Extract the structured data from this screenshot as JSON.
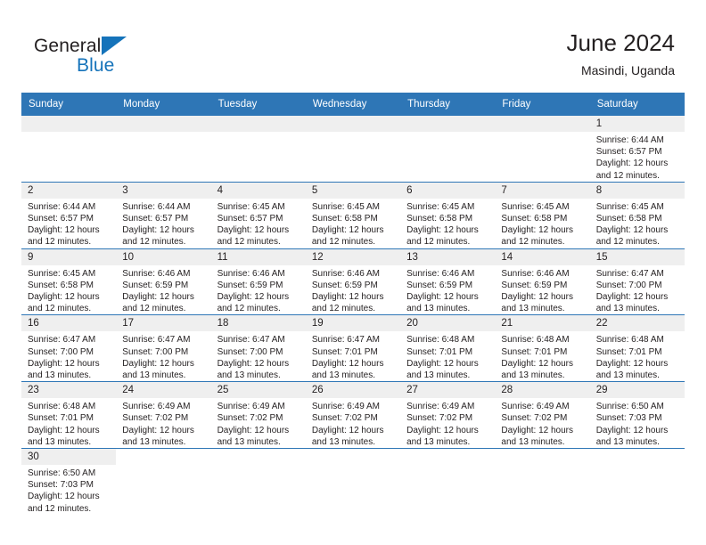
{
  "brand": {
    "name_part1": "General",
    "name_part2": "Blue",
    "triangle_color": "#1573ba"
  },
  "header": {
    "title": "June 2024",
    "subtitle": "Masindi, Uganda"
  },
  "theme": {
    "header_bg": "#2e76b6",
    "header_text": "#ffffff",
    "daynum_bg": "#efefef",
    "text": "#231f20"
  },
  "weekdays": [
    "Sunday",
    "Monday",
    "Tuesday",
    "Wednesday",
    "Thursday",
    "Friday",
    "Saturday"
  ],
  "labels": {
    "sunrise": "Sunrise:",
    "sunset": "Sunset:",
    "daylight": "Daylight:"
  },
  "weeks": [
    [
      {
        "empty": true
      },
      {
        "empty": true
      },
      {
        "empty": true
      },
      {
        "empty": true
      },
      {
        "empty": true
      },
      {
        "empty": true
      },
      {
        "day": "1",
        "sunrise": "Sunrise: 6:44 AM",
        "sunset": "Sunset: 6:57 PM",
        "daylight": "Daylight: 12 hours and 12 minutes."
      }
    ],
    [
      {
        "day": "2",
        "sunrise": "Sunrise: 6:44 AM",
        "sunset": "Sunset: 6:57 PM",
        "daylight": "Daylight: 12 hours and 12 minutes."
      },
      {
        "day": "3",
        "sunrise": "Sunrise: 6:44 AM",
        "sunset": "Sunset: 6:57 PM",
        "daylight": "Daylight: 12 hours and 12 minutes."
      },
      {
        "day": "4",
        "sunrise": "Sunrise: 6:45 AM",
        "sunset": "Sunset: 6:57 PM",
        "daylight": "Daylight: 12 hours and 12 minutes."
      },
      {
        "day": "5",
        "sunrise": "Sunrise: 6:45 AM",
        "sunset": "Sunset: 6:58 PM",
        "daylight": "Daylight: 12 hours and 12 minutes."
      },
      {
        "day": "6",
        "sunrise": "Sunrise: 6:45 AM",
        "sunset": "Sunset: 6:58 PM",
        "daylight": "Daylight: 12 hours and 12 minutes."
      },
      {
        "day": "7",
        "sunrise": "Sunrise: 6:45 AM",
        "sunset": "Sunset: 6:58 PM",
        "daylight": "Daylight: 12 hours and 12 minutes."
      },
      {
        "day": "8",
        "sunrise": "Sunrise: 6:45 AM",
        "sunset": "Sunset: 6:58 PM",
        "daylight": "Daylight: 12 hours and 12 minutes."
      }
    ],
    [
      {
        "day": "9",
        "sunrise": "Sunrise: 6:45 AM",
        "sunset": "Sunset: 6:58 PM",
        "daylight": "Daylight: 12 hours and 12 minutes."
      },
      {
        "day": "10",
        "sunrise": "Sunrise: 6:46 AM",
        "sunset": "Sunset: 6:59 PM",
        "daylight": "Daylight: 12 hours and 12 minutes."
      },
      {
        "day": "11",
        "sunrise": "Sunrise: 6:46 AM",
        "sunset": "Sunset: 6:59 PM",
        "daylight": "Daylight: 12 hours and 12 minutes."
      },
      {
        "day": "12",
        "sunrise": "Sunrise: 6:46 AM",
        "sunset": "Sunset: 6:59 PM",
        "daylight": "Daylight: 12 hours and 12 minutes."
      },
      {
        "day": "13",
        "sunrise": "Sunrise: 6:46 AM",
        "sunset": "Sunset: 6:59 PM",
        "daylight": "Daylight: 12 hours and 13 minutes."
      },
      {
        "day": "14",
        "sunrise": "Sunrise: 6:46 AM",
        "sunset": "Sunset: 6:59 PM",
        "daylight": "Daylight: 12 hours and 13 minutes."
      },
      {
        "day": "15",
        "sunrise": "Sunrise: 6:47 AM",
        "sunset": "Sunset: 7:00 PM",
        "daylight": "Daylight: 12 hours and 13 minutes."
      }
    ],
    [
      {
        "day": "16",
        "sunrise": "Sunrise: 6:47 AM",
        "sunset": "Sunset: 7:00 PM",
        "daylight": "Daylight: 12 hours and 13 minutes."
      },
      {
        "day": "17",
        "sunrise": "Sunrise: 6:47 AM",
        "sunset": "Sunset: 7:00 PM",
        "daylight": "Daylight: 12 hours and 13 minutes."
      },
      {
        "day": "18",
        "sunrise": "Sunrise: 6:47 AM",
        "sunset": "Sunset: 7:00 PM",
        "daylight": "Daylight: 12 hours and 13 minutes."
      },
      {
        "day": "19",
        "sunrise": "Sunrise: 6:47 AM",
        "sunset": "Sunset: 7:01 PM",
        "daylight": "Daylight: 12 hours and 13 minutes."
      },
      {
        "day": "20",
        "sunrise": "Sunrise: 6:48 AM",
        "sunset": "Sunset: 7:01 PM",
        "daylight": "Daylight: 12 hours and 13 minutes."
      },
      {
        "day": "21",
        "sunrise": "Sunrise: 6:48 AM",
        "sunset": "Sunset: 7:01 PM",
        "daylight": "Daylight: 12 hours and 13 minutes."
      },
      {
        "day": "22",
        "sunrise": "Sunrise: 6:48 AM",
        "sunset": "Sunset: 7:01 PM",
        "daylight": "Daylight: 12 hours and 13 minutes."
      }
    ],
    [
      {
        "day": "23",
        "sunrise": "Sunrise: 6:48 AM",
        "sunset": "Sunset: 7:01 PM",
        "daylight": "Daylight: 12 hours and 13 minutes."
      },
      {
        "day": "24",
        "sunrise": "Sunrise: 6:49 AM",
        "sunset": "Sunset: 7:02 PM",
        "daylight": "Daylight: 12 hours and 13 minutes."
      },
      {
        "day": "25",
        "sunrise": "Sunrise: 6:49 AM",
        "sunset": "Sunset: 7:02 PM",
        "daylight": "Daylight: 12 hours and 13 minutes."
      },
      {
        "day": "26",
        "sunrise": "Sunrise: 6:49 AM",
        "sunset": "Sunset: 7:02 PM",
        "daylight": "Daylight: 12 hours and 13 minutes."
      },
      {
        "day": "27",
        "sunrise": "Sunrise: 6:49 AM",
        "sunset": "Sunset: 7:02 PM",
        "daylight": "Daylight: 12 hours and 13 minutes."
      },
      {
        "day": "28",
        "sunrise": "Sunrise: 6:49 AM",
        "sunset": "Sunset: 7:02 PM",
        "daylight": "Daylight: 12 hours and 13 minutes."
      },
      {
        "day": "29",
        "sunrise": "Sunrise: 6:50 AM",
        "sunset": "Sunset: 7:03 PM",
        "daylight": "Daylight: 12 hours and 13 minutes."
      }
    ],
    [
      {
        "day": "30",
        "sunrise": "Sunrise: 6:50 AM",
        "sunset": "Sunset: 7:03 PM",
        "daylight": "Daylight: 12 hours and 12 minutes."
      },
      {
        "blank": true
      },
      {
        "blank": true
      },
      {
        "blank": true
      },
      {
        "blank": true
      },
      {
        "blank": true
      },
      {
        "blank": true
      }
    ]
  ]
}
